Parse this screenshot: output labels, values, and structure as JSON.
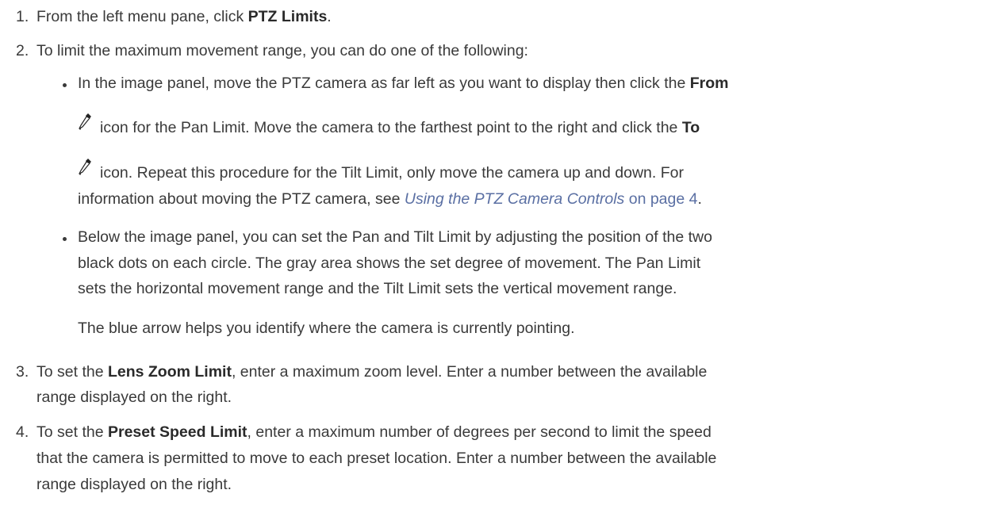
{
  "steps": [
    {
      "number": "1.",
      "pre": "From the left menu pane, click ",
      "bold": "PTZ Limits",
      "post": "."
    },
    {
      "number": "2.",
      "text": "To limit the maximum movement range, you can do one of the following:",
      "bullets": [
        {
          "line1_pre": "In the image panel, move the PTZ camera as far left as you want to display then click the ",
          "line1_bold": "From",
          "icon1": "eyedropper-icon",
          "line2_pre": "icon for the Pan Limit. Move the camera to the farthest point to the right and click the ",
          "line2_bold": "To",
          "icon2": "eyedropper-icon",
          "line3": "icon. Repeat this procedure for the Tilt Limit, only move the camera up and down. For",
          "line4_pre": "information about moving the PTZ camera, see ",
          "line4_link": "Using the PTZ Camera Controls",
          "line4_mid": " on page ",
          "line4_page": "4",
          "line4_post": "."
        },
        {
          "line1": "Below the image panel, you can set the Pan and Tilt Limit by adjusting the position of the two",
          "line2": "black dots on each circle. The gray area shows the set degree of movement. The Pan Limit",
          "line3": "sets the horizontal movement range and the Tilt Limit sets the vertical movement range.",
          "note": "The blue arrow helps you identify where the camera is currently pointing."
        }
      ]
    },
    {
      "number": "3.",
      "pre": "To set the ",
      "bold": "Lens Zoom Limit",
      "post": ", enter a maximum zoom level. Enter a number between the available",
      "line2": "range displayed on the right."
    },
    {
      "number": "4.",
      "pre": "To set the ",
      "bold": "Preset Speed Limit",
      "post": ", enter a maximum number of degrees per second to limit the speed",
      "line2": "that the camera is permitted to move to each preset location. Enter a number between the available",
      "line3": "range displayed on the right."
    }
  ]
}
